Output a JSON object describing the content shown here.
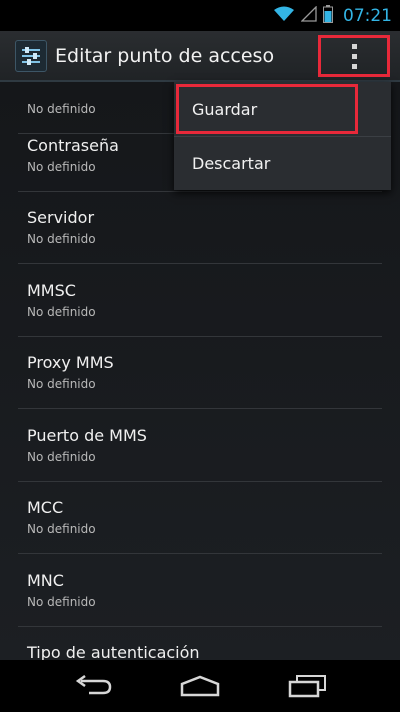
{
  "status_bar": {
    "time": "07:21",
    "accent_color": "#33b5e5",
    "icons": [
      "wifi-icon",
      "signal-icon",
      "battery-icon"
    ]
  },
  "action_bar": {
    "app_icon": "settings-icon",
    "title": "Editar punto de acceso",
    "overflow_icon": "overflow-menu-icon"
  },
  "menu": {
    "items": [
      {
        "label": "Guardar"
      },
      {
        "label": "Descartar"
      }
    ],
    "highlight_color": "#e8293a"
  },
  "list": {
    "items": [
      {
        "title": "",
        "subtitle": "No definido"
      },
      {
        "title": "Contraseña",
        "subtitle": "No definido"
      },
      {
        "title": "Servidor",
        "subtitle": "No definido"
      },
      {
        "title": "MMSC",
        "subtitle": "No definido"
      },
      {
        "title": "Proxy MMS",
        "subtitle": "No definido"
      },
      {
        "title": "Puerto de MMS",
        "subtitle": "No definido"
      },
      {
        "title": "MCC",
        "subtitle": "No definido"
      },
      {
        "title": "MNC",
        "subtitle": "No definido"
      },
      {
        "title": "Tipo de autenticación",
        "subtitle": ""
      }
    ]
  },
  "nav_bar": {
    "icons": [
      "back-icon",
      "home-icon",
      "recent-apps-icon"
    ]
  }
}
